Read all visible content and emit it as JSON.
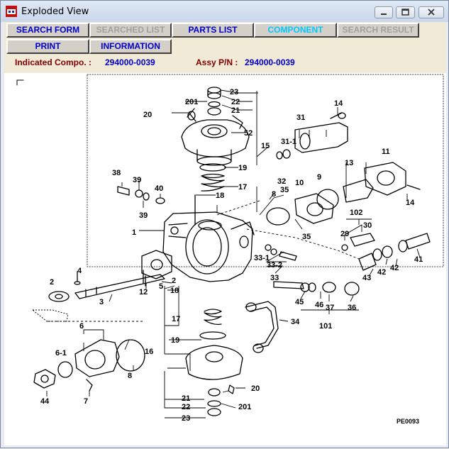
{
  "window": {
    "title": "Exploded View"
  },
  "toolbar": {
    "buttons": [
      {
        "label": "SEARCH FORM",
        "state": "enabled"
      },
      {
        "label": "SEARCHED LIST",
        "state": "disabled"
      },
      {
        "label": "PARTS LIST",
        "state": "enabled"
      },
      {
        "label": "COMPONENT",
        "state": "active"
      },
      {
        "label": "SEARCH RESULT",
        "state": "disabled"
      },
      {
        "label": "PRINT",
        "state": "enabled"
      },
      {
        "label": "INFORMATION",
        "state": "enabled"
      }
    ]
  },
  "info": {
    "indicated_label": "Indicated Compo. :",
    "indicated_value": "294000-0039",
    "assy_label": "Assy P/N :",
    "assy_value": "294000-0039"
  },
  "diagram": {
    "drawing_code": "PE0093",
    "callouts": [
      "23",
      "201",
      "22",
      "21",
      "20",
      "52",
      "15",
      "19",
      "17",
      "18",
      "31",
      "31-1",
      "14",
      "38",
      "39",
      "40",
      "39",
      "32",
      "10",
      "9",
      "13",
      "11",
      "14",
      "8",
      "35",
      "1",
      "35",
      "102",
      "29",
      "30",
      "4",
      "33-1",
      "33-2",
      "33",
      "41",
      "42",
      "42",
      "43",
      "2",
      "2",
      "5",
      "12",
      "18",
      "3",
      "45",
      "46",
      "37",
      "36",
      "101",
      "34",
      "6",
      "6-1",
      "17",
      "19",
      "16",
      "8",
      "20",
      "21",
      "22",
      "201",
      "23",
      "44",
      "7"
    ],
    "colors": {
      "line": "#000000",
      "background": "#ffffff"
    }
  }
}
